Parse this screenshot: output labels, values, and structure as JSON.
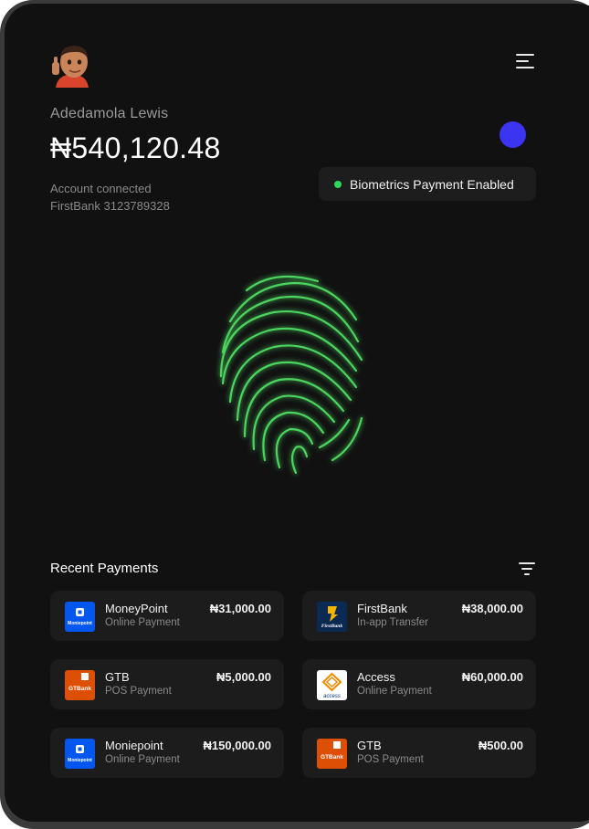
{
  "user": {
    "name": "Adedamola Lewis",
    "balance": "₦540,120.48"
  },
  "account": {
    "label": "Account connected",
    "detail": "FirstBank 3123789328"
  },
  "biometrics": {
    "label": "Biometrics Payment Enabled"
  },
  "colors": {
    "accent_blue": "#3b34f0",
    "status_green": "#2fd85a",
    "fingerprint_green": "#4cd45e",
    "background": "#111111",
    "card": "#1c1c1c"
  },
  "recent": {
    "title": "Recent Payments",
    "payments": [
      {
        "title": "MoneyPoint",
        "subtitle": "Online Payment",
        "amount": "₦31,000.00",
        "logo": "moniepoint-logo",
        "logo_text": "Moniepoint"
      },
      {
        "title": "FirstBank",
        "subtitle": "In-app Transfer",
        "amount": "₦38,000.00",
        "logo": "firstbank-logo",
        "logo_text": "FirstBank"
      },
      {
        "title": "GTB",
        "subtitle": "POS Payment",
        "amount": "₦5,000.00",
        "logo": "gtbank-logo",
        "logo_text": "GTBank"
      },
      {
        "title": "Access",
        "subtitle": "Online Payment",
        "amount": "₦60,000.00",
        "logo": "access-logo",
        "logo_text": "access"
      },
      {
        "title": "Moniepoint",
        "subtitle": "Online Payment",
        "amount": "₦150,000.00",
        "logo": "moniepoint-logo",
        "logo_text": "Moniepoint"
      },
      {
        "title": "GTB",
        "subtitle": "POS Payment",
        "amount": "₦500.00",
        "logo": "gtbank-logo",
        "logo_text": "GTBank"
      }
    ]
  }
}
